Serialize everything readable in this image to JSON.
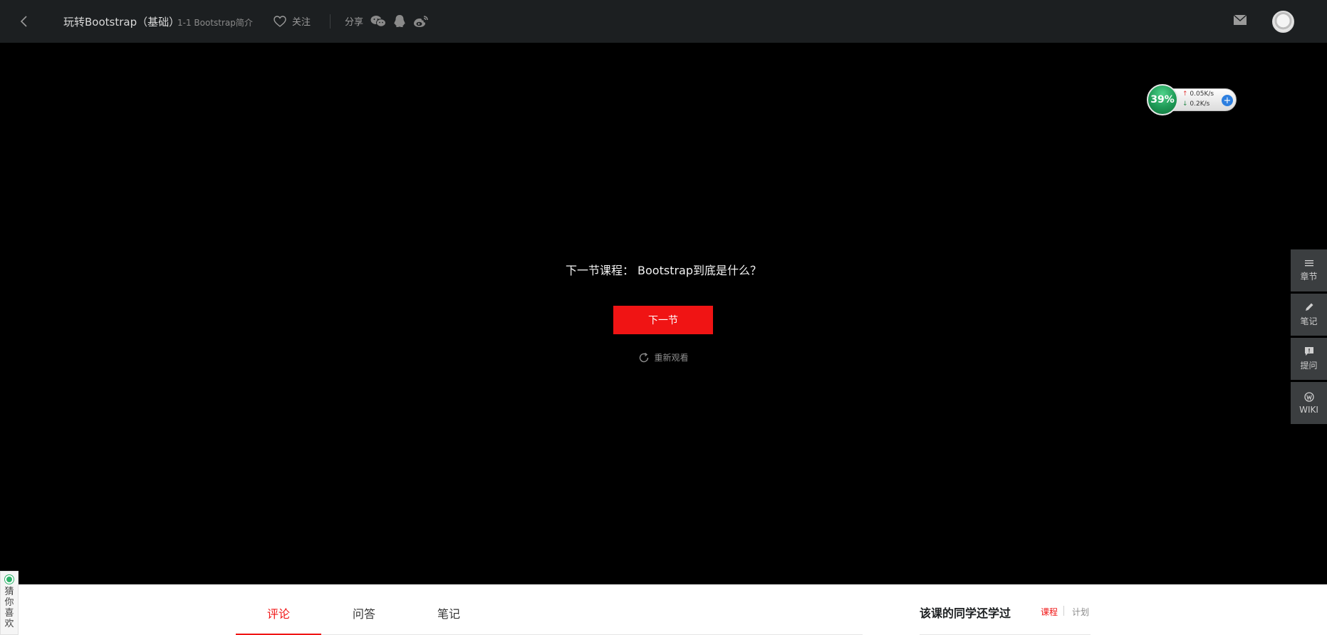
{
  "header": {
    "course_title": "玩转Bootstrap（基础）",
    "lesson_title": "1-1 Bootstrap简介",
    "follow_label": "关注",
    "share_label": "分享"
  },
  "player": {
    "next_title": "下一节课程： Bootstrap到底是什么？",
    "next_button": "下一节",
    "replay_label": "重新观看"
  },
  "net_widget": {
    "percent": "39%",
    "upload": "0.05K/s",
    "download": "0.2K/s"
  },
  "side_bar": {
    "items": [
      {
        "label": "章节",
        "icon": "menu-icon"
      },
      {
        "label": "笔记",
        "icon": "pencil-icon"
      },
      {
        "label": "提问",
        "icon": "question-bubble-icon"
      },
      {
        "label": "WIKI",
        "icon": "wiki-icon"
      }
    ]
  },
  "tabs": {
    "items": [
      {
        "label": "评论",
        "active": true
      },
      {
        "label": "问答",
        "active": false
      },
      {
        "label": "笔记",
        "active": false
      }
    ]
  },
  "related": {
    "title": "该课的同学还学过",
    "tab_course": "课程",
    "tab_plan": "计划"
  },
  "guess": {
    "label": "猜你喜欢"
  },
  "colors": {
    "header_bg": "#1c1f21",
    "accent": "#f01414",
    "side_bg": "#3b3e40"
  }
}
